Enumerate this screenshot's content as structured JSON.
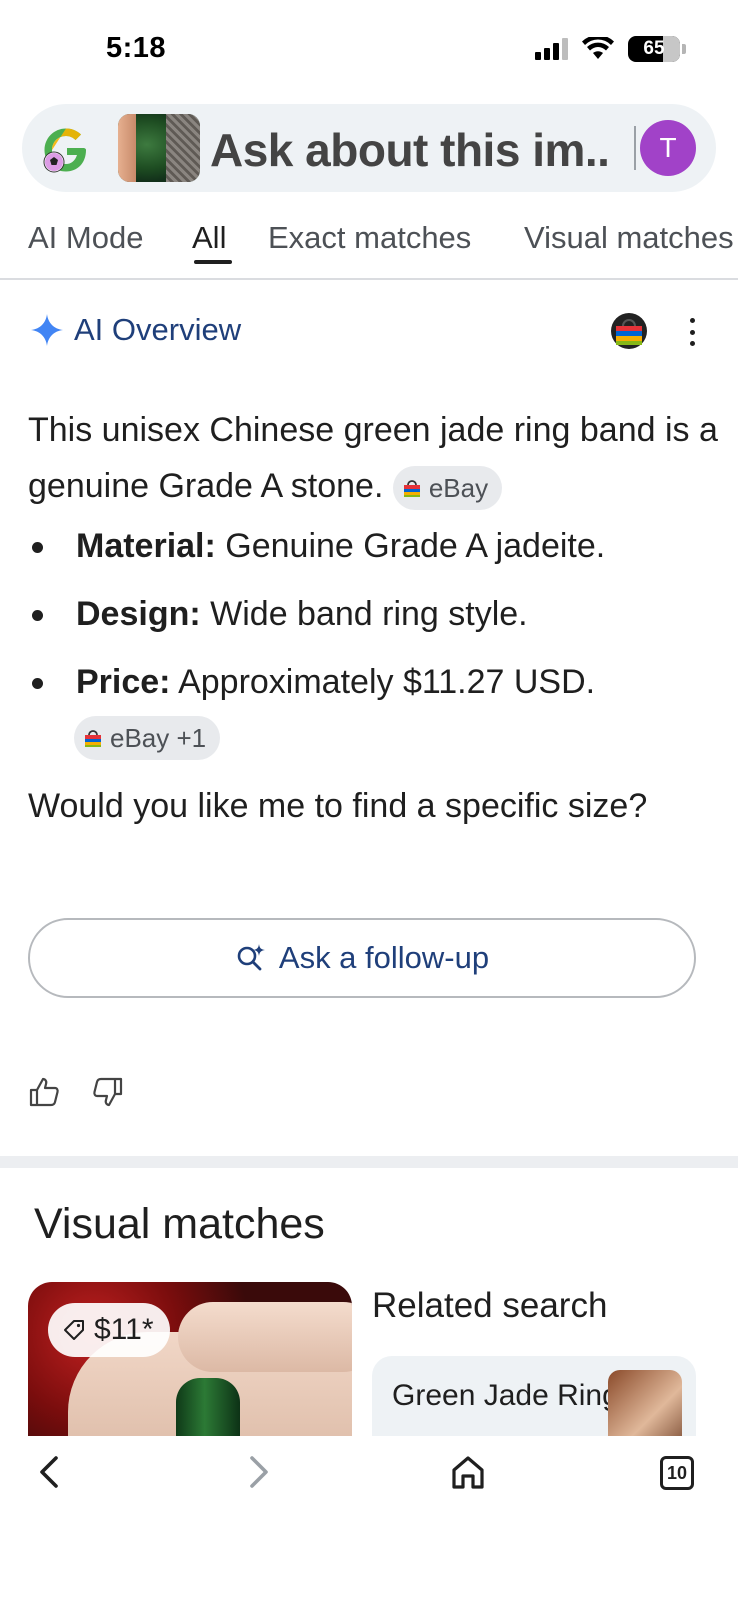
{
  "status_bar": {
    "time": "5:18",
    "battery": "65"
  },
  "search": {
    "query": "Ask about this im..",
    "avatar_letter": "T"
  },
  "tabs": [
    {
      "label": "AI Mode",
      "active": false
    },
    {
      "label": "All",
      "active": true
    },
    {
      "label": "Exact matches",
      "active": false
    },
    {
      "label": "Visual matches",
      "active": false
    }
  ],
  "ai_overview": {
    "title": "AI Overview",
    "intro": "This unisex Chinese green jade ring band is a genuine Grade A stone.",
    "intro_source": "eBay",
    "bullets": [
      {
        "label": "Material:",
        "text": " Genuine Grade A jadeite."
      },
      {
        "label": "Design:",
        "text": " Wide band ring style."
      },
      {
        "label": "Price:",
        "text": " Approximately $11.27 USD."
      }
    ],
    "price_source": "eBay +1",
    "question": "Would you like me to find a specific size?",
    "followup_label": "Ask a follow-up"
  },
  "visual_matches": {
    "title": "Visual matches",
    "price_tag": "$11*",
    "related_title": "Related search",
    "related_item": "Green Jade Ring"
  },
  "bottom_nav": {
    "tabs_count": "10"
  },
  "colors": {
    "accent_blue": "#1f3f7a",
    "avatar_purple": "#a142c8",
    "gemini_blue": "#4285f4"
  }
}
